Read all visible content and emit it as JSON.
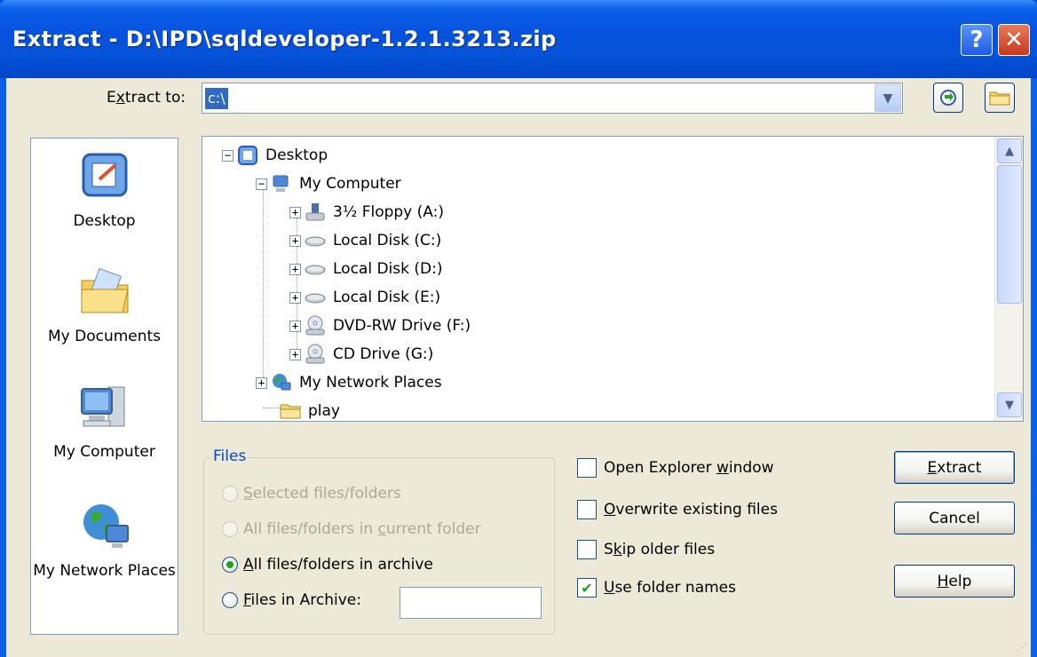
{
  "window": {
    "title": "Extract - D:\\IPD\\sqldeveloper-1.2.1.3213.zip",
    "help_button": "?",
    "close_button": "✕"
  },
  "extract_to": {
    "label": "Extract to:",
    "value": "c:\\",
    "dropdown_icon": "chevron-down-icon",
    "navigate_button_icon": "refresh-arrow-icon",
    "browse_button_icon": "folder-icon"
  },
  "places": [
    {
      "label": "Desktop",
      "icon": "desktop-icon"
    },
    {
      "label": "My Documents",
      "icon": "my-documents-icon"
    },
    {
      "label": "My Computer",
      "icon": "my-computer-icon"
    },
    {
      "label": "My Network Places",
      "icon": "network-places-icon"
    }
  ],
  "tree": [
    {
      "label": "Desktop",
      "icon": "desktop-icon",
      "expander": "−"
    },
    {
      "label": "My Computer",
      "icon": "my-computer-icon",
      "expander": "−"
    },
    {
      "label": "3½ Floppy (A:)",
      "icon": "floppy-drive-icon",
      "expander": "+"
    },
    {
      "label": "Local Disk (C:)",
      "icon": "hard-disk-icon",
      "expander": "+"
    },
    {
      "label": "Local Disk (D:)",
      "icon": "hard-disk-icon",
      "expander": "+"
    },
    {
      "label": "Local Disk (E:)",
      "icon": "hard-disk-icon",
      "expander": "+"
    },
    {
      "label": "DVD-RW Drive (F:)",
      "icon": "dvd-drive-icon",
      "expander": "+"
    },
    {
      "label": "CD Drive (G:)",
      "icon": "cd-drive-icon",
      "expander": "+"
    },
    {
      "label": "My Network Places",
      "icon": "network-places-icon",
      "expander": "+"
    },
    {
      "label": "play",
      "icon": "folder-icon",
      "expander": ""
    }
  ],
  "files_group": {
    "title": "Files",
    "options": [
      {
        "pre": "",
        "key": "S",
        "post": "elected files/folders",
        "checked": false,
        "disabled": true
      },
      {
        "pre": "All files/folders in ",
        "key": "c",
        "post": "urrent folder",
        "checked": false,
        "disabled": true
      },
      {
        "pre": "",
        "key": "A",
        "post": "ll files/folders in archive",
        "checked": true,
        "disabled": false
      },
      {
        "pre": "",
        "key": "F",
        "post": "iles in Archive:",
        "checked": false,
        "disabled": false
      }
    ],
    "files_in_archive_value": ""
  },
  "checkboxes": [
    {
      "pre": "Open Explorer ",
      "key": "w",
      "post": "indow",
      "checked": false
    },
    {
      "pre": "",
      "key": "O",
      "post": "verwrite existing files",
      "checked": false
    },
    {
      "pre": "S",
      "key": "k",
      "post": "ip older files",
      "checked": false
    },
    {
      "pre": "",
      "key": "U",
      "post": "se folder names",
      "checked": true
    }
  ],
  "buttons": {
    "extract": {
      "pre": "",
      "key": "E",
      "post": "xtract"
    },
    "cancel": {
      "label": "Cancel"
    },
    "help": {
      "pre": "",
      "key": "H",
      "post": "elp"
    }
  },
  "colors": {
    "title_bar": "#0553d8",
    "dialog_bg": "#ece9d8",
    "selection": "#316ac5",
    "group_title": "#0046d5",
    "checkmark": "#21a121"
  }
}
